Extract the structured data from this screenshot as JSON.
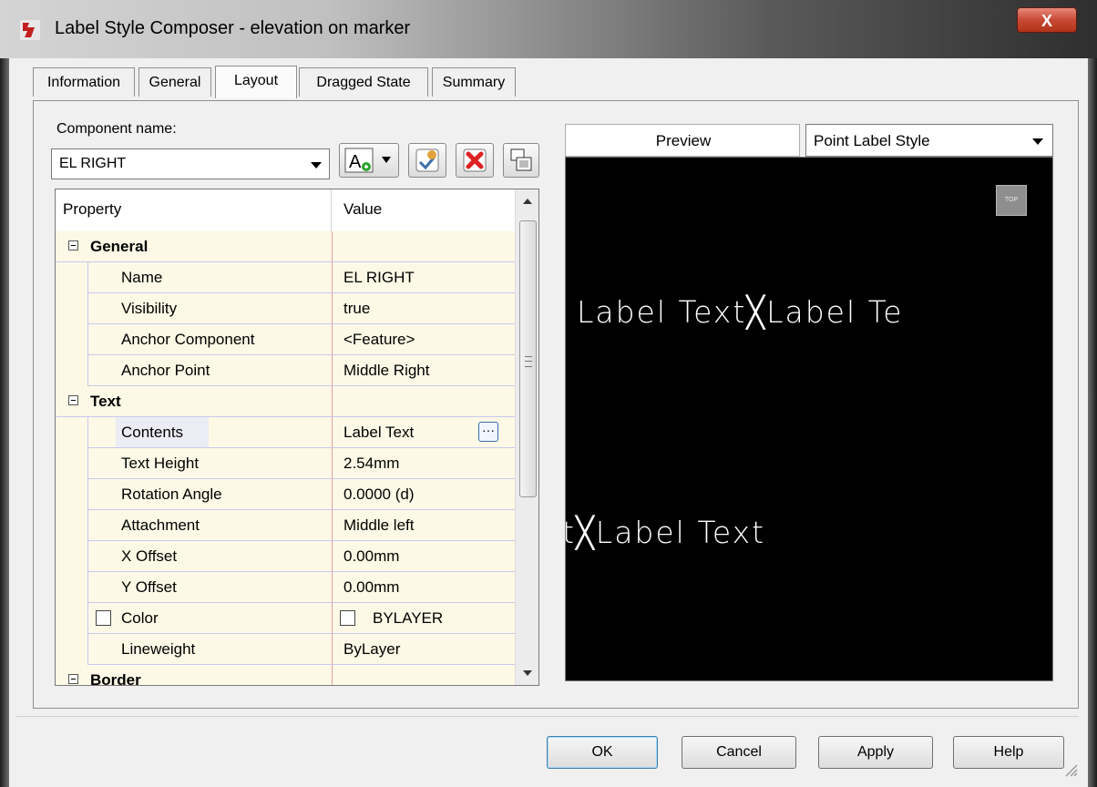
{
  "window": {
    "title": "Label Style Composer - elevation on marker",
    "close_label": "X"
  },
  "tabs": [
    {
      "label": "Information"
    },
    {
      "label": "General"
    },
    {
      "label": "Layout"
    },
    {
      "label": "Dragged State"
    },
    {
      "label": "Summary"
    }
  ],
  "active_tab": "Layout",
  "component": {
    "label": "Component name:",
    "selected": "EL RIGHT"
  },
  "toolbar": {
    "add_text_label": "A"
  },
  "grid": {
    "header": {
      "property": "Property",
      "value": "Value"
    },
    "rows": [
      {
        "kind": "category",
        "property": "General",
        "value": ""
      },
      {
        "kind": "item",
        "property": "Name",
        "value": "EL RIGHT"
      },
      {
        "kind": "item",
        "property": "Visibility",
        "value": "true"
      },
      {
        "kind": "item",
        "property": "Anchor Component",
        "value": "<Feature>"
      },
      {
        "kind": "item",
        "property": "Anchor Point",
        "value": "Middle Right"
      },
      {
        "kind": "category",
        "property": "Text",
        "value": ""
      },
      {
        "kind": "item",
        "property": "Contents",
        "value": "Label Text",
        "ellipsis": "···"
      },
      {
        "kind": "item",
        "property": "Text Height",
        "value": "2.54mm"
      },
      {
        "kind": "item",
        "property": "Rotation Angle",
        "value": "0.0000 (d)"
      },
      {
        "kind": "item",
        "property": "Attachment",
        "value": "Middle left"
      },
      {
        "kind": "item",
        "property": "X Offset",
        "value": "0.00mm"
      },
      {
        "kind": "item",
        "property": "Y Offset",
        "value": "0.00mm"
      },
      {
        "kind": "item",
        "property": "Color",
        "value": "BYLAYER"
      },
      {
        "kind": "item",
        "property": "Lineweight",
        "value": "ByLayer"
      },
      {
        "kind": "category",
        "property": "Border",
        "value": ""
      }
    ]
  },
  "preview": {
    "label": "Preview",
    "style_selected": "Point Label Style",
    "viewcube_label": "TOP",
    "line1": "Label  Text╳Label  Te",
    "line2": "t╳Label  Text"
  },
  "buttons": {
    "ok": "OK",
    "cancel": "Cancel",
    "apply": "Apply",
    "help": "Help"
  }
}
